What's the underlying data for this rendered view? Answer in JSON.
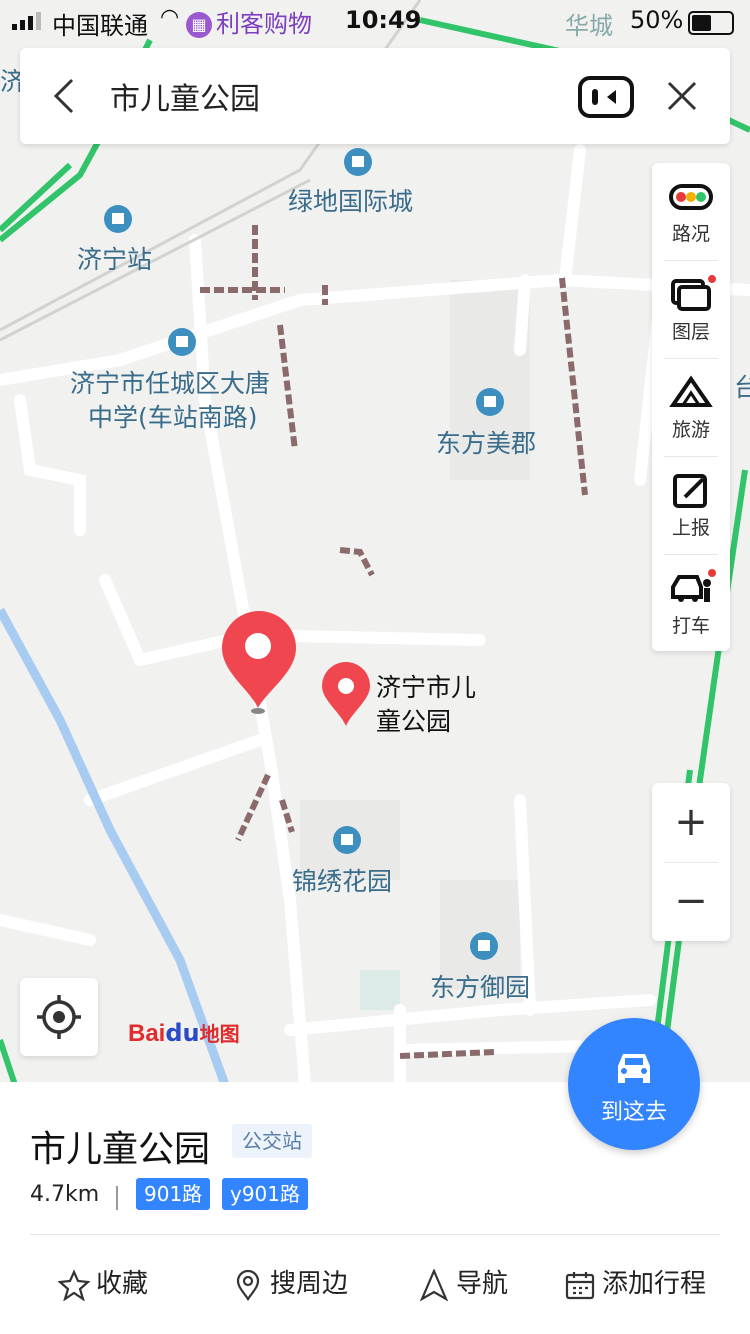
{
  "status_bar": {
    "carrier": "中国联通",
    "app_chip": "利客购物",
    "time": "10:49",
    "location_text": "华城",
    "battery": "50%"
  },
  "search": {
    "query": "市儿童公园"
  },
  "toolbar": {
    "items": [
      {
        "label": "路况",
        "icon": "traffic-light-icon"
      },
      {
        "label": "图层",
        "icon": "layers-icon"
      },
      {
        "label": "旅游",
        "icon": "travel-icon"
      },
      {
        "label": "上报",
        "icon": "report-icon"
      },
      {
        "label": "打车",
        "icon": "taxi-icon"
      }
    ]
  },
  "zoom": {
    "in_label": "+",
    "out_label": "−"
  },
  "map_labels": {
    "lvdi": "绿地国际城",
    "station": "济宁站",
    "school_1": "济宁市任城区大唐",
    "school_2": "中学(车站南路)",
    "dongfang_meijun": "东方美郡",
    "target_1": "济宁市儿",
    "target_2": "童公园",
    "jinxiu": "锦绣花园",
    "dongfang_yuyuan": "东方御园",
    "edge_ji": "济",
    "edge_tai": "台"
  },
  "logo": {
    "bai": "Bai",
    "du": "du",
    "ditu": "地图"
  },
  "go_button": {
    "label": "到这去"
  },
  "place": {
    "name": "市儿童公园",
    "type": "公交站",
    "distance": "4.7km",
    "routes": [
      "901路",
      "y901路"
    ]
  },
  "actions": [
    {
      "label": "收藏",
      "icon": "star-icon"
    },
    {
      "label": "搜周边",
      "icon": "pin-search-icon"
    },
    {
      "label": "导航",
      "icon": "navigation-arrow-icon"
    },
    {
      "label": "添加行程",
      "icon": "calendar-icon"
    }
  ],
  "colors": {
    "accent": "#3385ff",
    "marker": "#f0464f",
    "poi": "#3d8fbf",
    "traffic_green": "#31c46a"
  }
}
